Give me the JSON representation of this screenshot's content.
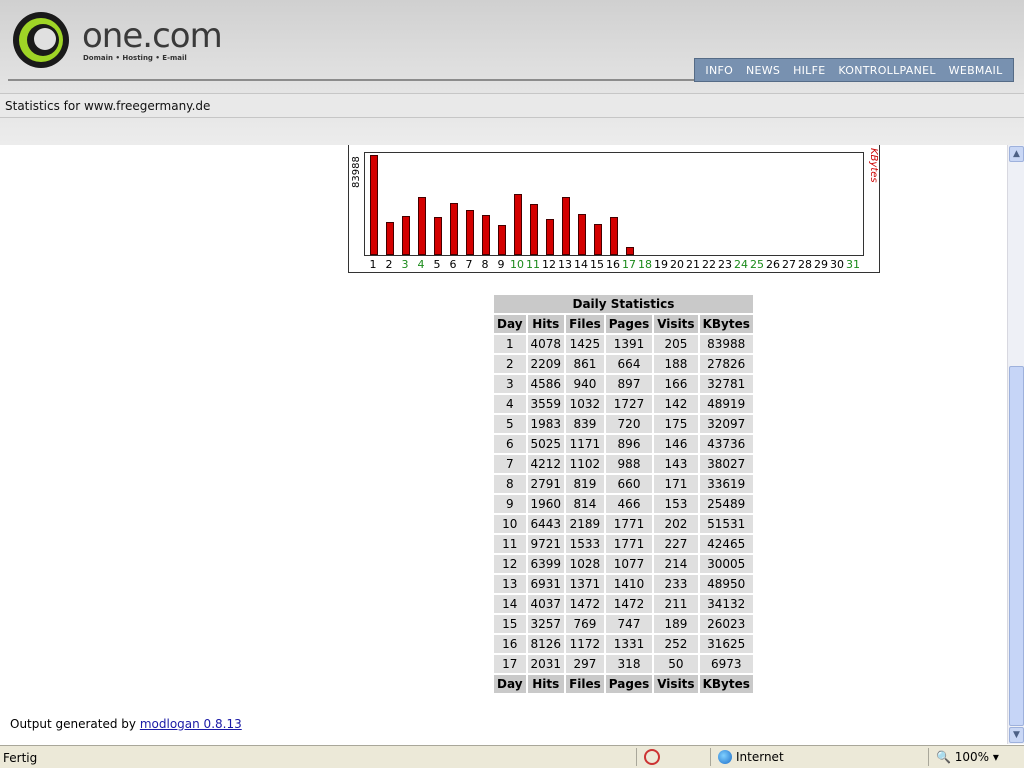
{
  "brand": {
    "name": "one.com",
    "tagline": "Domain • Hosting • E-mail"
  },
  "nav": [
    "INFO",
    "NEWS",
    "HILFE",
    "KONTROLLPANEL",
    "WEBMAIL"
  ],
  "stats_title": "Statistics for www.freegermany.de",
  "chart": {
    "max_label": "83988",
    "unit_label": "KBytes",
    "day_labels": [
      "1",
      "2",
      "3",
      "4",
      "5",
      "6",
      "7",
      "8",
      "9",
      "10",
      "11",
      "12",
      "13",
      "14",
      "15",
      "16",
      "17",
      "18",
      "19",
      "20",
      "21",
      "22",
      "23",
      "24",
      "25",
      "26",
      "27",
      "28",
      "29",
      "30",
      "31"
    ],
    "weekend_days": [
      "3",
      "4",
      "10",
      "11",
      "17",
      "18",
      "24",
      "25",
      "31"
    ],
    "bar_color": "#d40000",
    "weekend_color": "#1a8a1a"
  },
  "chart_data": {
    "type": "bar",
    "categories": [
      "1",
      "2",
      "3",
      "4",
      "5",
      "6",
      "7",
      "8",
      "9",
      "10",
      "11",
      "12",
      "13",
      "14",
      "15",
      "16",
      "17",
      "18",
      "19",
      "20",
      "21",
      "22",
      "23",
      "24",
      "25",
      "26",
      "27",
      "28",
      "29",
      "30",
      "31"
    ],
    "values": [
      83988,
      27826,
      32781,
      48919,
      32097,
      43736,
      38027,
      33619,
      25489,
      51531,
      42465,
      30005,
      48950,
      34132,
      26023,
      31625,
      6973
    ],
    "ylabel": "KBytes",
    "ylim": [
      0,
      83988
    ]
  },
  "table": {
    "title": "Daily Statistics",
    "headers": [
      "Day",
      "Hits",
      "Files",
      "Pages",
      "Visits",
      "KBytes"
    ],
    "rows": [
      [
        "1",
        "4078",
        "1425",
        "1391",
        "205",
        "83988"
      ],
      [
        "2",
        "2209",
        "861",
        "664",
        "188",
        "27826"
      ],
      [
        "3",
        "4586",
        "940",
        "897",
        "166",
        "32781"
      ],
      [
        "4",
        "3559",
        "1032",
        "1727",
        "142",
        "48919"
      ],
      [
        "5",
        "1983",
        "839",
        "720",
        "175",
        "32097"
      ],
      [
        "6",
        "5025",
        "1171",
        "896",
        "146",
        "43736"
      ],
      [
        "7",
        "4212",
        "1102",
        "988",
        "143",
        "38027"
      ],
      [
        "8",
        "2791",
        "819",
        "660",
        "171",
        "33619"
      ],
      [
        "9",
        "1960",
        "814",
        "466",
        "153",
        "25489"
      ],
      [
        "10",
        "6443",
        "2189",
        "1771",
        "202",
        "51531"
      ],
      [
        "11",
        "9721",
        "1533",
        "1771",
        "227",
        "42465"
      ],
      [
        "12",
        "6399",
        "1028",
        "1077",
        "214",
        "30005"
      ],
      [
        "13",
        "6931",
        "1371",
        "1410",
        "233",
        "48950"
      ],
      [
        "14",
        "4037",
        "1472",
        "1472",
        "211",
        "34132"
      ],
      [
        "15",
        "3257",
        "769",
        "747",
        "189",
        "26023"
      ],
      [
        "16",
        "8126",
        "1172",
        "1331",
        "252",
        "31625"
      ],
      [
        "17",
        "2031",
        "297",
        "318",
        "50",
        "6973"
      ]
    ]
  },
  "footer": {
    "prefix": "Output generated by",
    "link_text": "modlogan 0.8.13"
  },
  "statusbar": {
    "status": "Fertig",
    "zone": "Internet",
    "zoom": "100%"
  }
}
